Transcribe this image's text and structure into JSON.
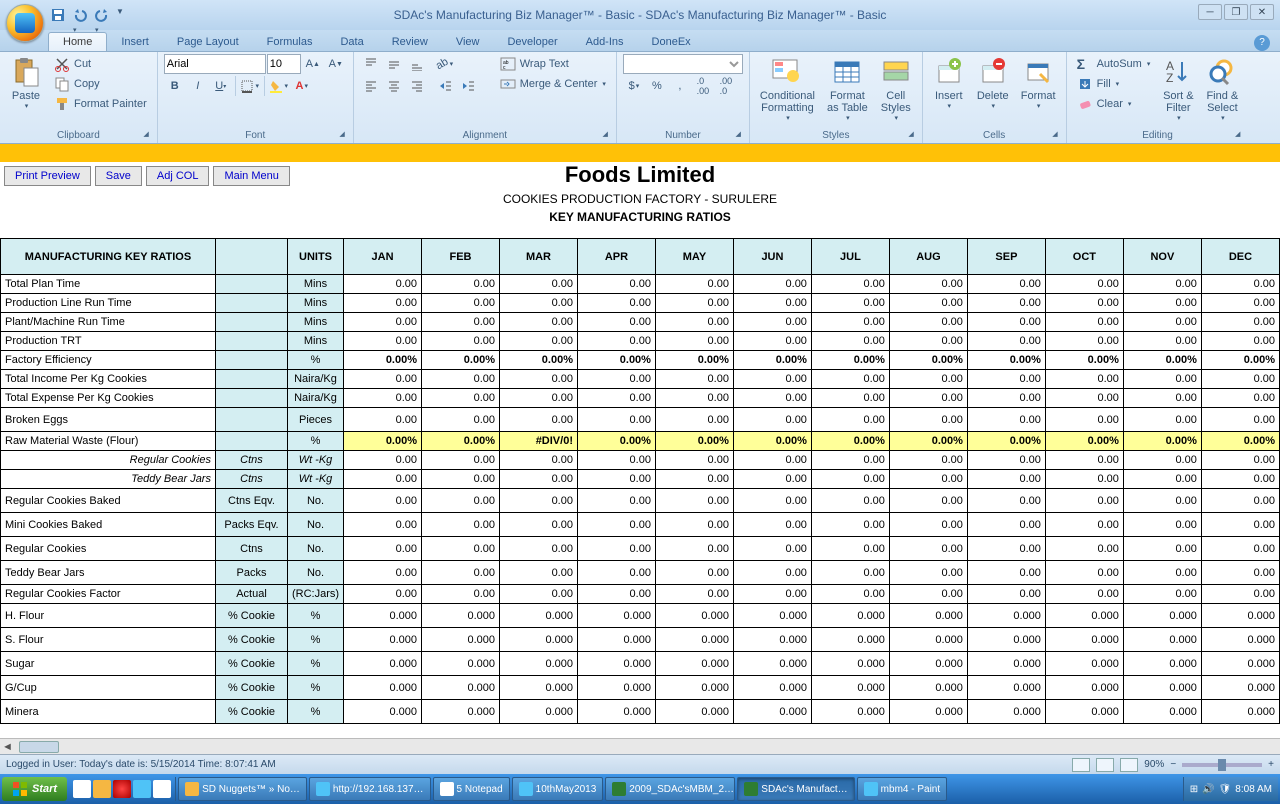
{
  "app": {
    "title": "SDAc's Manufacturing Biz Manager™ - Basic - SDAc's Manufacturing Biz Manager™ - Basic"
  },
  "tabs": [
    "Home",
    "Insert",
    "Page Layout",
    "Formulas",
    "Data",
    "Review",
    "View",
    "Developer",
    "Add-Ins",
    "DoneEx"
  ],
  "ribbon": {
    "clipboard": {
      "paste": "Paste",
      "cut": "Cut",
      "copy": "Copy",
      "fmtpaint": "Format Painter",
      "label": "Clipboard"
    },
    "font": {
      "name": "Arial",
      "size": "10",
      "label": "Font"
    },
    "align": {
      "wrap": "Wrap Text",
      "merge": "Merge & Center",
      "label": "Alignment"
    },
    "number": {
      "label": "Number"
    },
    "styles": {
      "cond": "Conditional\nFormatting",
      "fmtas": "Format\nas Table",
      "cell": "Cell\nStyles",
      "label": "Styles"
    },
    "cells": {
      "insert": "Insert",
      "delete": "Delete",
      "format": "Format",
      "label": "Cells"
    },
    "editing": {
      "autosum": "AutoSum",
      "fill": "Fill",
      "clear": "Clear",
      "sort": "Sort &\nFilter",
      "find": "Find &\nSelect",
      "label": "Editing"
    }
  },
  "toolbar": {
    "print": "Print Preview",
    "save": "Save",
    "adj": "Adj COL",
    "menu": "Main Menu"
  },
  "report": {
    "title": "Foods Limited",
    "sub": "COOKIES PRODUCTION FACTORY - SURULERE",
    "sub2": "KEY MANUFACTURING RATIOS"
  },
  "headers": {
    "main": "MANUFACTURING KEY RATIOS",
    "sub": "",
    "units": "UNITS",
    "months": [
      "JAN",
      "FEB",
      "MAR",
      "APR",
      "MAY",
      "JUN",
      "JUL",
      "AUG",
      "SEP",
      "OCT",
      "NOV",
      "DEC"
    ]
  },
  "rows": [
    {
      "name": "Total Plan Time",
      "sub": "",
      "unit": "Mins",
      "vals": [
        "0.00",
        "0.00",
        "0.00",
        "0.00",
        "0.00",
        "0.00",
        "0.00",
        "0.00",
        "0.00",
        "0.00",
        "0.00",
        "0.00"
      ]
    },
    {
      "name": "Production Line Run Time",
      "sub": "",
      "unit": "Mins",
      "vals": [
        "0.00",
        "0.00",
        "0.00",
        "0.00",
        "0.00",
        "0.00",
        "0.00",
        "0.00",
        "0.00",
        "0.00",
        "0.00",
        "0.00"
      ]
    },
    {
      "name": "Plant/Machine Run Time",
      "sub": "",
      "unit": "Mins",
      "vals": [
        "0.00",
        "0.00",
        "0.00",
        "0.00",
        "0.00",
        "0.00",
        "0.00",
        "0.00",
        "0.00",
        "0.00",
        "0.00",
        "0.00"
      ]
    },
    {
      "name": "Production TRT",
      "sub": "",
      "unit": "Mins",
      "vals": [
        "0.00",
        "0.00",
        "0.00",
        "0.00",
        "0.00",
        "0.00",
        "0.00",
        "0.00",
        "0.00",
        "0.00",
        "0.00",
        "0.00"
      ]
    },
    {
      "name": "Factory Efficiency",
      "sub": "",
      "unit": "%",
      "bold": true,
      "vals": [
        "0.00%",
        "0.00%",
        "0.00%",
        "0.00%",
        "0.00%",
        "0.00%",
        "0.00%",
        "0.00%",
        "0.00%",
        "0.00%",
        "0.00%",
        "0.00%"
      ]
    },
    {
      "name": "Total Income Per Kg Cookies",
      "sub": "",
      "unit": "Naira/Kg",
      "vals": [
        "0.00",
        "0.00",
        "0.00",
        "0.00",
        "0.00",
        "0.00",
        "0.00",
        "0.00",
        "0.00",
        "0.00",
        "0.00",
        "0.00"
      ]
    },
    {
      "name": "Total Expense Per Kg Cookies",
      "sub": "",
      "unit": "Naira/Kg",
      "vals": [
        "0.00",
        "0.00",
        "0.00",
        "0.00",
        "0.00",
        "0.00",
        "0.00",
        "0.00",
        "0.00",
        "0.00",
        "0.00",
        "0.00"
      ]
    },
    {
      "name": "Broken Eggs",
      "sub": "",
      "unit": "Pieces",
      "tall": true,
      "vals": [
        "0.00",
        "0.00",
        "0.00",
        "0.00",
        "0.00",
        "0.00",
        "0.00",
        "0.00",
        "0.00",
        "0.00",
        "0.00",
        "0.00"
      ]
    },
    {
      "name": "Raw Material Waste (Flour)",
      "sub": "",
      "unit": "%",
      "yellow": true,
      "bold": true,
      "vals": [
        "0.00%",
        "0.00%",
        "#DIV/0!",
        "0.00%",
        "0.00%",
        "0.00%",
        "0.00%",
        "0.00%",
        "0.00%",
        "0.00%",
        "0.00%",
        "0.00%"
      ]
    },
    {
      "name": "Regular Cookies",
      "italic": true,
      "sub": "Ctns",
      "unit": "Wt -Kg",
      "subitalic": true,
      "vals": [
        "0.00",
        "0.00",
        "0.00",
        "0.00",
        "0.00",
        "0.00",
        "0.00",
        "0.00",
        "0.00",
        "0.00",
        "0.00",
        "0.00"
      ]
    },
    {
      "name": "Teddy Bear Jars",
      "italic": true,
      "sub": "Ctns",
      "unit": "Wt -Kg",
      "subitalic": true,
      "vals": [
        "0.00",
        "0.00",
        "0.00",
        "0.00",
        "0.00",
        "0.00",
        "0.00",
        "0.00",
        "0.00",
        "0.00",
        "0.00",
        "0.00"
      ]
    },
    {
      "name": "Regular Cookies Baked",
      "sub": "Ctns Eqv.",
      "unit": "No.",
      "tall": true,
      "vals": [
        "0.00",
        "0.00",
        "0.00",
        "0.00",
        "0.00",
        "0.00",
        "0.00",
        "0.00",
        "0.00",
        "0.00",
        "0.00",
        "0.00"
      ]
    },
    {
      "name": "Mini Cookies Baked",
      "sub": "Packs Eqv.",
      "unit": "No.",
      "tall": true,
      "vals": [
        "0.00",
        "0.00",
        "0.00",
        "0.00",
        "0.00",
        "0.00",
        "0.00",
        "0.00",
        "0.00",
        "0.00",
        "0.00",
        "0.00"
      ]
    },
    {
      "name": "Regular Cookies",
      "sub": "Ctns",
      "unit": "No.",
      "tall": true,
      "vals": [
        "0.00",
        "0.00",
        "0.00",
        "0.00",
        "0.00",
        "0.00",
        "0.00",
        "0.00",
        "0.00",
        "0.00",
        "0.00",
        "0.00"
      ]
    },
    {
      "name": "Teddy Bear Jars",
      "sub": "Packs",
      "unit": "No.",
      "tall": true,
      "vals": [
        "0.00",
        "0.00",
        "0.00",
        "0.00",
        "0.00",
        "0.00",
        "0.00",
        "0.00",
        "0.00",
        "0.00",
        "0.00",
        "0.00"
      ]
    },
    {
      "name": "Regular Cookies Factor",
      "sub": "Actual",
      "unit": "(RC:Jars)",
      "vals": [
        "0.00",
        "0.00",
        "0.00",
        "0.00",
        "0.00",
        "0.00",
        "0.00",
        "0.00",
        "0.00",
        "0.00",
        "0.00",
        "0.00"
      ]
    },
    {
      "name": "H. Flour",
      "sub": "% Cookie",
      "unit": "%",
      "tall": true,
      "vals": [
        "0.000",
        "0.000",
        "0.000",
        "0.000",
        "0.000",
        "0.000",
        "0.000",
        "0.000",
        "0.000",
        "0.000",
        "0.000",
        "0.000"
      ]
    },
    {
      "name": "S. Flour",
      "sub": "% Cookie",
      "unit": "%",
      "tall": true,
      "vals": [
        "0.000",
        "0.000",
        "0.000",
        "0.000",
        "0.000",
        "0.000",
        "0.000",
        "0.000",
        "0.000",
        "0.000",
        "0.000",
        "0.000"
      ]
    },
    {
      "name": "Sugar",
      "sub": "% Cookie",
      "unit": "%",
      "tall": true,
      "vals": [
        "0.000",
        "0.000",
        "0.000",
        "0.000",
        "0.000",
        "0.000",
        "0.000",
        "0.000",
        "0.000",
        "0.000",
        "0.000",
        "0.000"
      ]
    },
    {
      "name": "G/Cup",
      "sub": "% Cookie",
      "unit": "%",
      "tall": true,
      "vals": [
        "0.000",
        "0.000",
        "0.000",
        "0.000",
        "0.000",
        "0.000",
        "0.000",
        "0.000",
        "0.000",
        "0.000",
        "0.000",
        "0.000"
      ]
    },
    {
      "name": "Minera",
      "sub": "% Cookie",
      "unit": "%",
      "tall": true,
      "vals": [
        "0.000",
        "0.000",
        "0.000",
        "0.000",
        "0.000",
        "0.000",
        "0.000",
        "0.000",
        "0.000",
        "0.000",
        "0.000",
        "0.000"
      ]
    }
  ],
  "status": {
    "text": "Logged in User:  Today's date is: 5/15/2014 Time: 8:07:41 AM",
    "zoom": "90%"
  },
  "taskbar": {
    "start": "Start",
    "items": [
      "SD Nuggets™ » No…",
      "http://192.168.137…",
      "5 Notepad",
      "10thMay2013",
      "2009_SDAc'sMBM_2…",
      "SDAc's Manufact…",
      "mbm4 - Paint"
    ],
    "time": "8:08 AM"
  }
}
